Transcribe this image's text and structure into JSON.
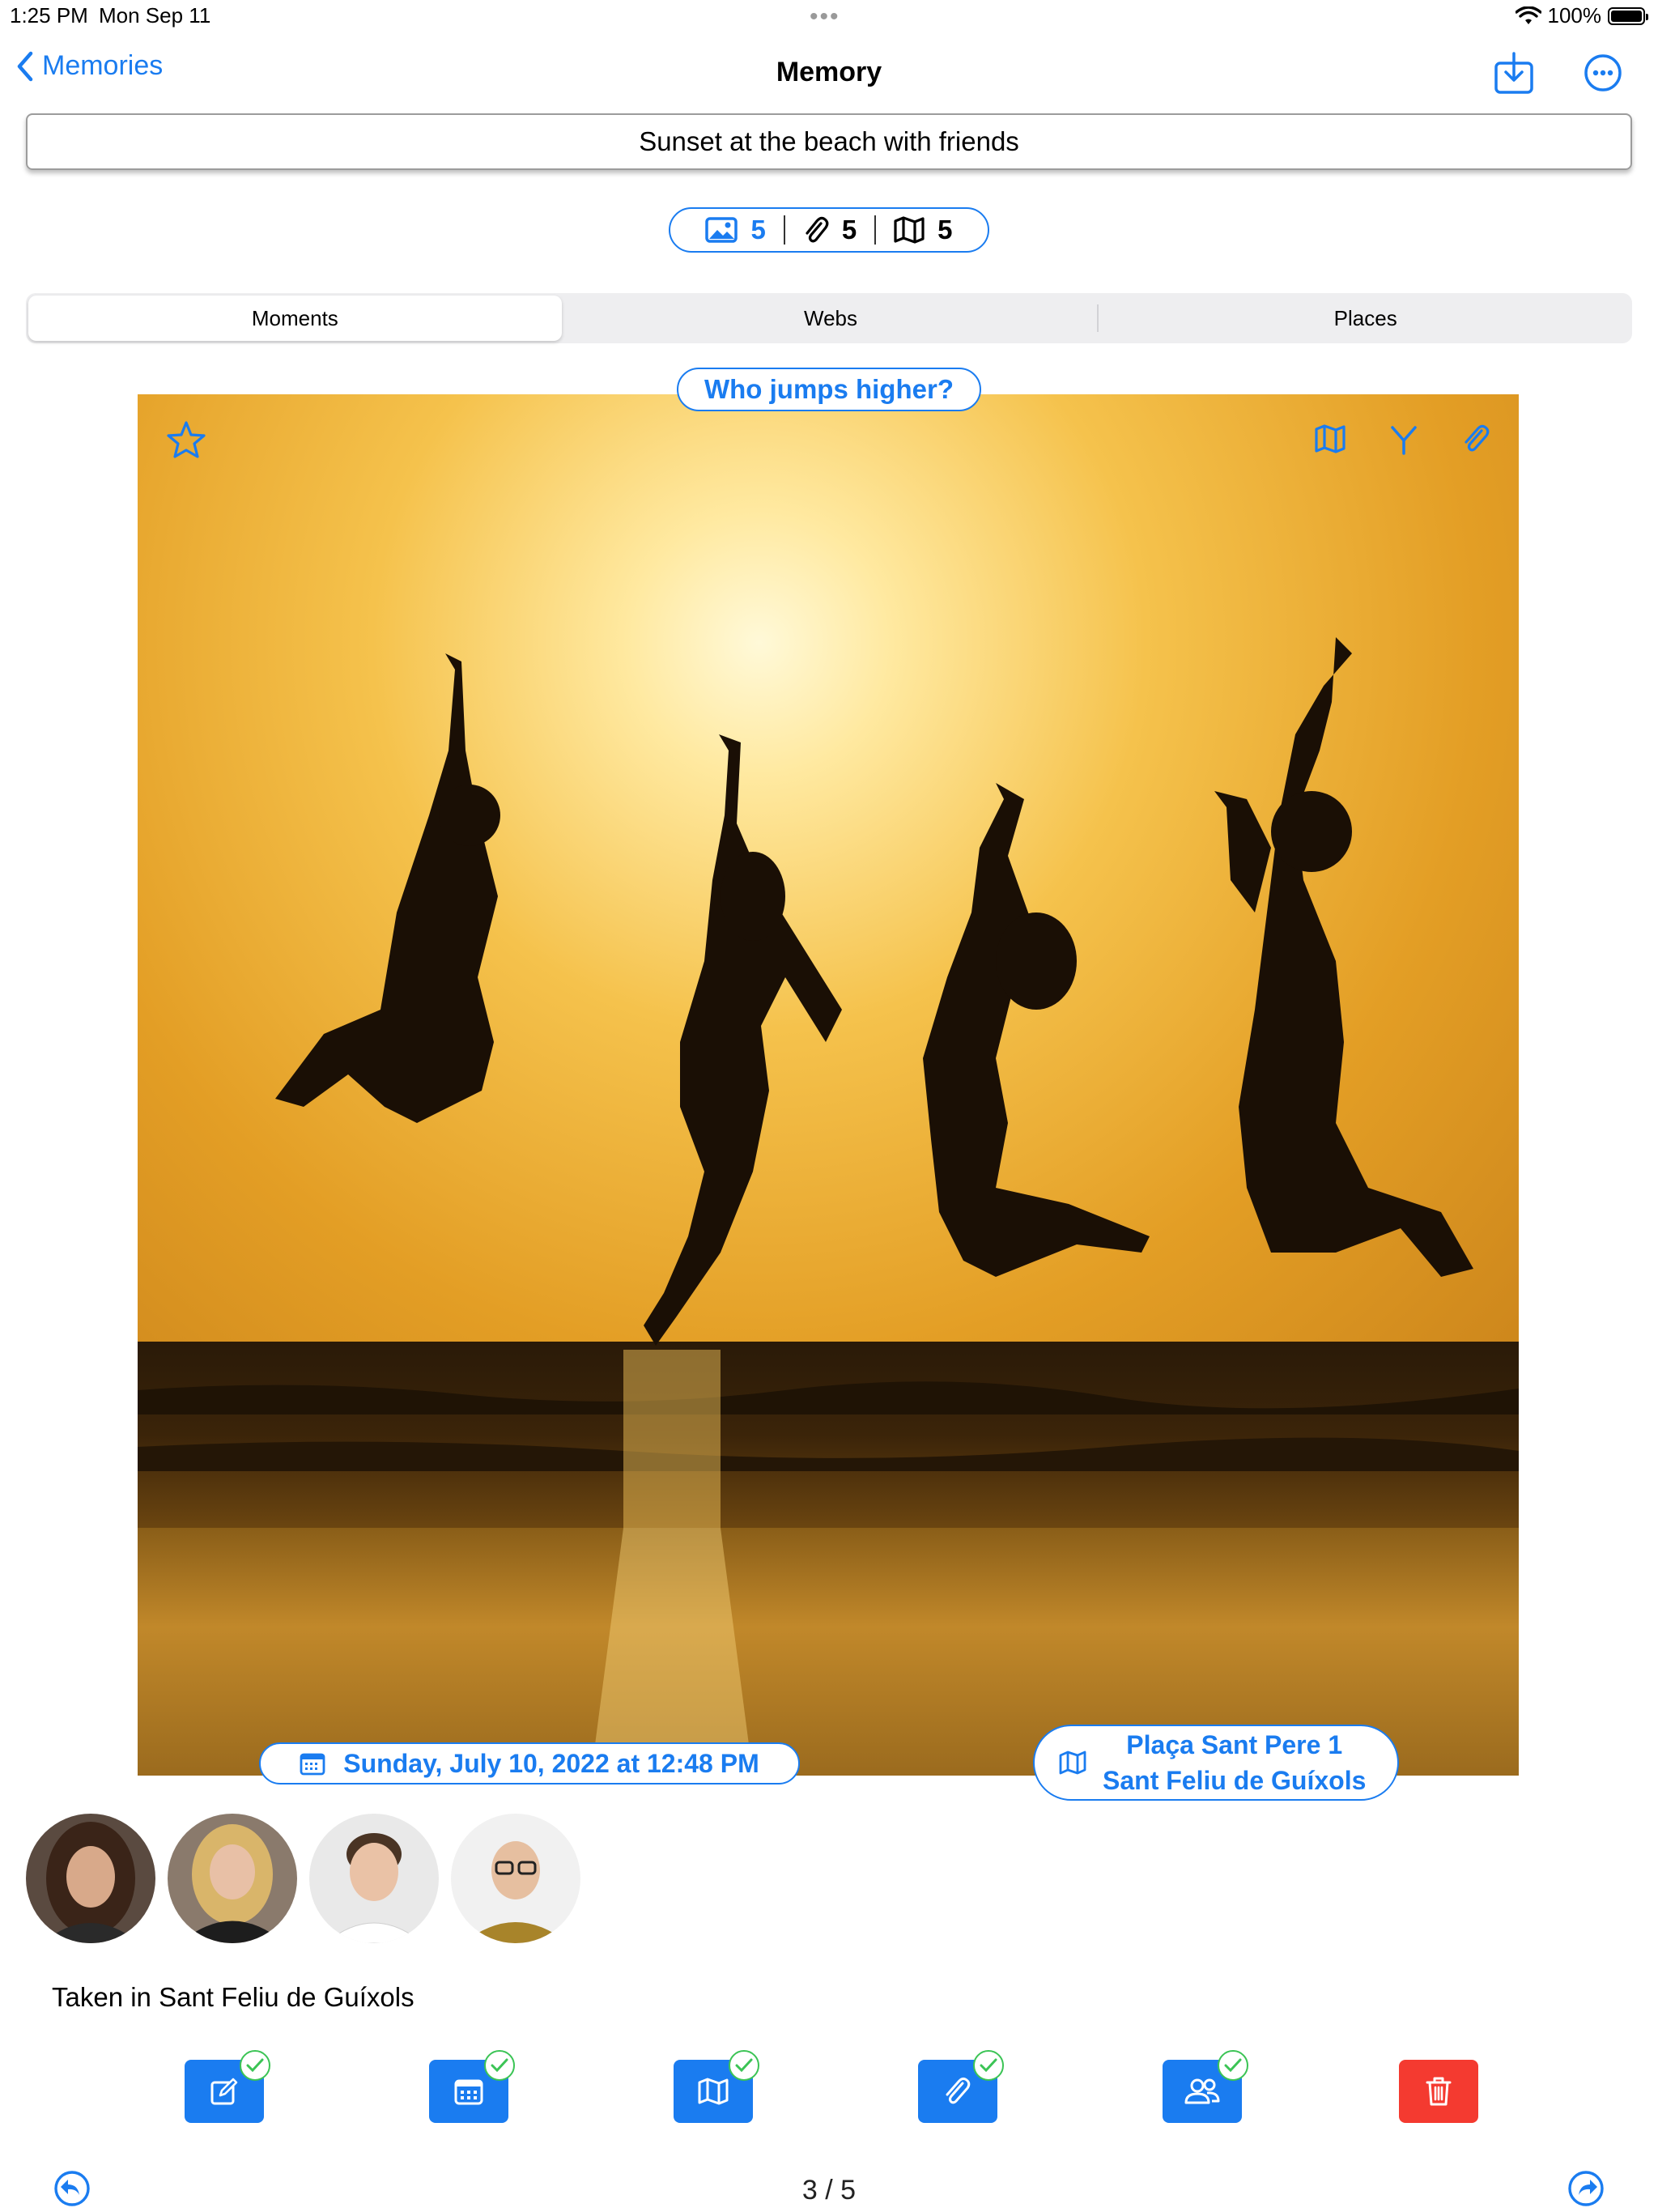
{
  "status_bar": {
    "time": "1:25 PM",
    "date": "Mon Sep 11",
    "battery": "100%",
    "battery_level": 1.0
  },
  "nav": {
    "back_label": "Memories",
    "title": "Memory"
  },
  "memory_title": "Sunset at the beach with friends",
  "counts": {
    "photos": "5",
    "attachments": "5",
    "places": "5"
  },
  "segments": [
    "Moments",
    "Webs",
    "Places"
  ],
  "active_segment": "Moments",
  "moment": {
    "title": "Who jumps higher?",
    "date": "Sunday, July 10, 2022 at 12:48 PM",
    "place_line1": "Plaça Sant Pere 1",
    "place_line2": "Sant Feliu de Guíxols"
  },
  "people": [
    {
      "icon": "avatar-woman-brown-hair"
    },
    {
      "icon": "avatar-woman-blonde"
    },
    {
      "icon": "avatar-man-white-shirt"
    },
    {
      "icon": "avatar-man-glasses"
    }
  ],
  "caption": "Taken in Sant Feliu de Guíxols",
  "actions": [
    {
      "icon": "edit-icon",
      "checked": true
    },
    {
      "icon": "calendar-icon",
      "checked": true
    },
    {
      "icon": "map-icon",
      "checked": true
    },
    {
      "icon": "paperclip-icon",
      "checked": true
    },
    {
      "icon": "people-icon",
      "checked": true
    },
    {
      "icon": "trash-icon",
      "checked": false
    }
  ],
  "pager": "3 / 5",
  "colors": {
    "accent": "#1a7cf0",
    "danger": "#f43a30",
    "check": "#3bc455",
    "sunset": "#e8a127"
  }
}
